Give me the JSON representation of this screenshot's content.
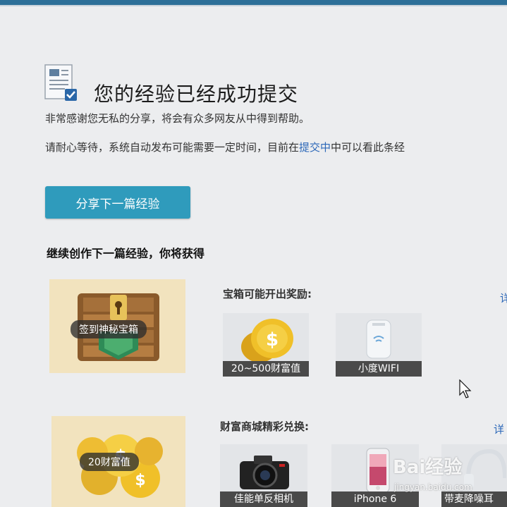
{
  "header": {
    "title": "您的经验已经成功提交",
    "subtitle_line1": "非常感谢您无私的分享，将会有众多网友从中得到帮助。",
    "subtitle_line2_prefix": "请耐心等待，系统自动发布可能需要一定时间，目前在",
    "subtitle_line2_link": "提交中",
    "subtitle_line2_suffix": "中可以看此条经"
  },
  "share_button": {
    "label": "分享下一篇经验"
  },
  "continue_heading": "继续创作下一篇经验，你将获得",
  "cards": [
    {
      "label": "签到神秘宝箱",
      "icon": "treasure-chest-icon"
    },
    {
      "label": "20财富值",
      "icon": "gold-coins-icon"
    }
  ],
  "sections": [
    {
      "title": "宝箱可能开出奖励:",
      "more": "详",
      "rewards": [
        {
          "label": "20~500财富值",
          "icon": "coin-icon"
        },
        {
          "label": "小度WIFI",
          "icon": "wifi-dongle-icon"
        }
      ]
    },
    {
      "title": "财富商城精彩兑换:",
      "more": "详",
      "rewards": [
        {
          "label": "佳能单反相机",
          "icon": "camera-icon"
        },
        {
          "label": "iPhone 6",
          "icon": "phone-icon"
        },
        {
          "label": "带麦降噪耳",
          "icon": "headphones-icon"
        }
      ]
    }
  ],
  "watermark": {
    "brand": "Bai经验",
    "url": "jingyan.baidu.com"
  },
  "colors": {
    "accent": "#2f9bbc",
    "link": "#2b67b8",
    "topbar": "#2d6f98",
    "card": "#f2e3be"
  }
}
